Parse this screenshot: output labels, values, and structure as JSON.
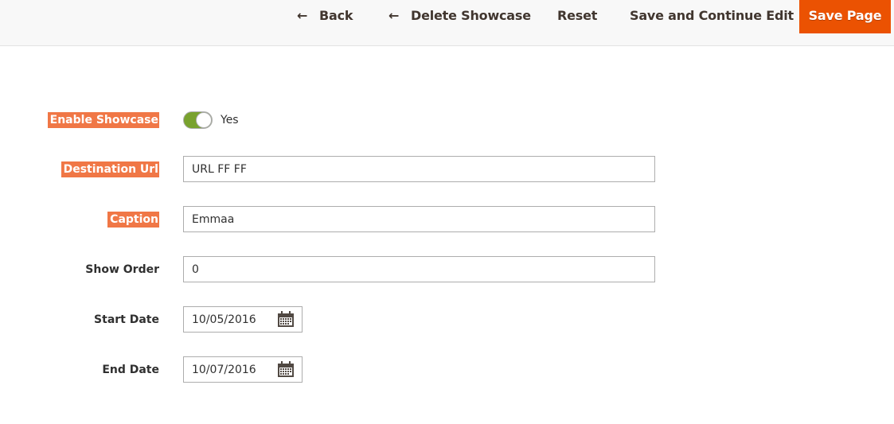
{
  "header": {
    "actions": [
      {
        "label": "Back",
        "icon": "arrow-left-icon"
      },
      {
        "label": "Delete Showcase",
        "icon": "arrow-left-icon"
      },
      {
        "label": "Reset"
      },
      {
        "label": "Save and Continue Edit"
      },
      {
        "label": "Save Page",
        "primary": true
      }
    ],
    "arrow_glyph": "←"
  },
  "colors": {
    "primary_button": "#eb5202",
    "label_highlight": "#f07746",
    "toggle_on": "#79a22e"
  },
  "form": {
    "enable_showcase": {
      "label": "Enable Showcase",
      "enabled": true,
      "state_text": "Yes"
    },
    "destination_url": {
      "label": "Destination Url",
      "value": "URL FF FF"
    },
    "caption": {
      "label": "Caption",
      "value": "Emmaa"
    },
    "show_order": {
      "label": "Show Order",
      "value": "0"
    },
    "start_date": {
      "label": "Start Date",
      "value": "10/05/2016",
      "icon": "calendar-icon"
    },
    "end_date": {
      "label": "End Date",
      "value": "10/07/2016",
      "icon": "calendar-icon"
    }
  }
}
